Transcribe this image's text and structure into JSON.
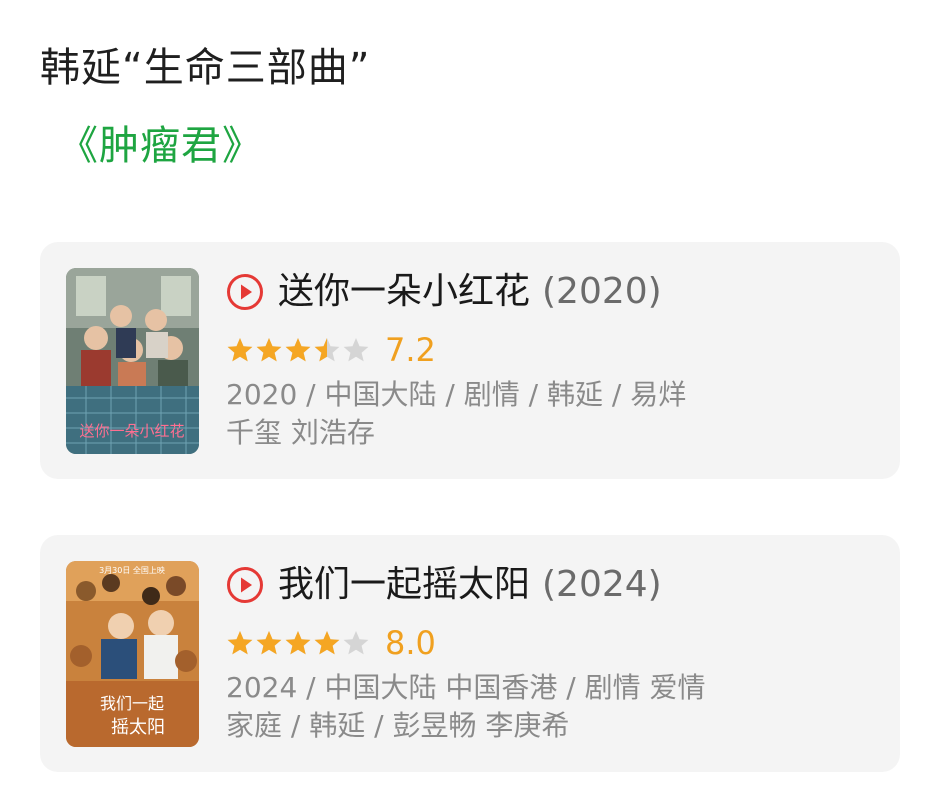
{
  "heading": "韩延“生命三部曲”",
  "link": "《肿瘤君》",
  "colors": {
    "accent_green": "#1ea541",
    "star_orange": "#f5a623",
    "star_gray": "#d5d5d5",
    "play_red": "#e53935"
  },
  "movies": [
    {
      "title": "送你一朵小红花",
      "year": "(2020)",
      "rating_stars": 3.5,
      "score": "7.2",
      "meta": "2020 / 中国大陆 / 剧情 / 韩延 / 易烊千玺 刘浩存",
      "poster_text": "送你一朵小红花",
      "poster_icon": "movie-poster-image"
    },
    {
      "title": "我们一起摇太阳",
      "year": "(2024)",
      "rating_stars": 4,
      "score": "8.0",
      "meta": "2024 / 中国大陆 中国香港 / 剧情 爱情 家庭 / 韩延 / 彭昱畅 李庚希",
      "poster_text": "我们一起摇太阳",
      "poster_icon": "movie-poster-image"
    }
  ]
}
